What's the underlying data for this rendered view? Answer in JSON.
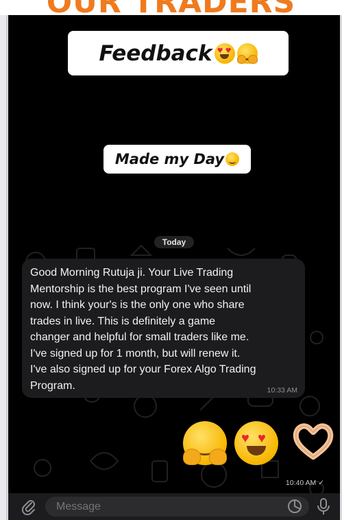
{
  "banner": {
    "text": "OUR TRADERS"
  },
  "stickers": {
    "main": "Feedback",
    "sub": "Made my Day"
  },
  "chat": {
    "date_label": "Today",
    "message": {
      "text": "Good Morning Rutuja ji. Your Live Trading\nMentorship is the best program I've seen until\nnow. I think your's is the only one who share\ntrades in live. This is definitely a game\nchanger and helpful for small traders like me.\nI've signed up for 1 month, but will renew it.\nI've also signed up for your Forex Algo Trading\nProgram.",
      "time": "10:33 AM"
    },
    "reply": {
      "emojis": [
        "hugging-face",
        "heart-eyes-face",
        "heart-hands"
      ],
      "time": "10:40 AM",
      "status": "✓"
    }
  },
  "input": {
    "placeholder": "Message"
  },
  "colors": {
    "banner": "#f07a1e",
    "background": "#000000",
    "bubble": "#1c1c1e",
    "input_bar": "#1c1c1e"
  }
}
